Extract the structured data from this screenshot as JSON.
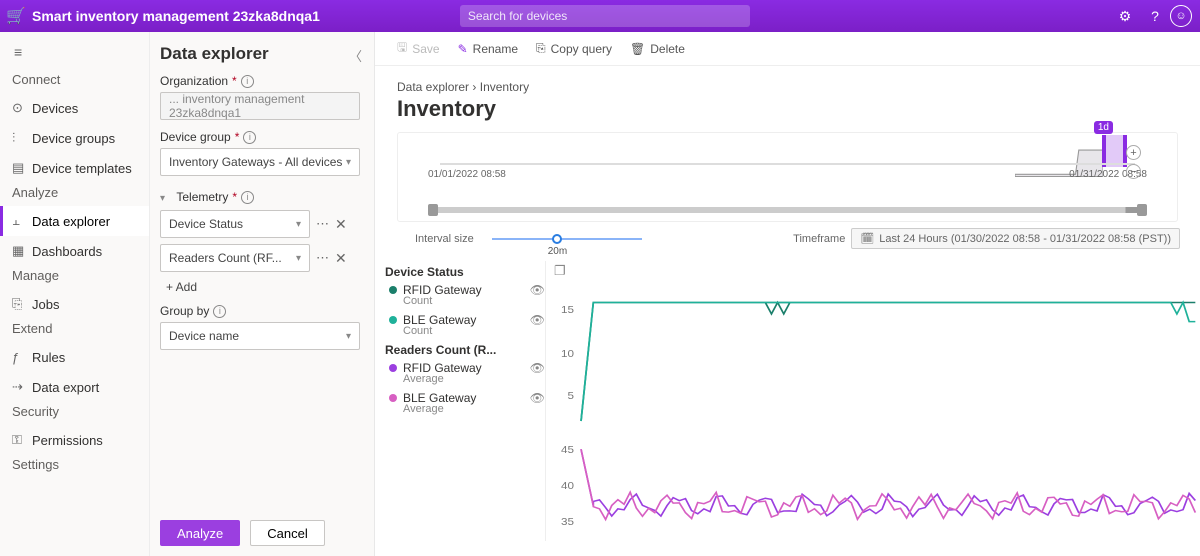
{
  "topbar": {
    "title": "Smart inventory management 23zka8dnqa1",
    "search_placeholder": "Search for devices",
    "avatar_initial": "☺"
  },
  "nav": {
    "groups": [
      {
        "label": "Connect",
        "items": [
          {
            "icon": "⊙",
            "label": "Devices"
          },
          {
            "icon": "⫶",
            "label": "Device groups"
          },
          {
            "icon": "▤",
            "label": "Device templates"
          }
        ]
      },
      {
        "label": "Analyze",
        "items": [
          {
            "icon": "⫠",
            "label": "Data explorer",
            "active": true
          },
          {
            "icon": "▦",
            "label": "Dashboards"
          }
        ]
      },
      {
        "label": "Manage",
        "items": [
          {
            "icon": "⎘",
            "label": "Jobs"
          }
        ]
      },
      {
        "label": "Extend",
        "items": [
          {
            "icon": "ƒ",
            "label": "Rules"
          },
          {
            "icon": "⇢",
            "label": "Data export"
          }
        ]
      },
      {
        "label": "Security",
        "items": [
          {
            "icon": "⚿",
            "label": "Permissions"
          }
        ]
      },
      {
        "label": "Settings",
        "items": []
      }
    ]
  },
  "panel": {
    "title": "Data explorer",
    "org_label": "Organization",
    "org_value": "... inventory management 23zka8dnqa1",
    "dg_label": "Device group",
    "dg_value": "Inventory Gateways - All devices",
    "tel_label": "Telemetry",
    "tel": [
      "Device Status",
      "Readers Count (RF..."
    ],
    "add": "+ Add",
    "groupby_label": "Group by",
    "groupby_value": "Device name",
    "analyze": "Analyze",
    "cancel": "Cancel"
  },
  "toolbar": {
    "save": "Save",
    "rename": "Rename",
    "copy": "Copy query",
    "delete": "Delete"
  },
  "crumb": {
    "root": "Data explorer",
    "leaf": "Inventory"
  },
  "page_title": "Inventory",
  "timeline": {
    "start": "01/01/2022 08:58",
    "end": "01/31/2022 08:58",
    "pill": "1d"
  },
  "controls": {
    "interval_label": "Interval size",
    "interval_value": "20m",
    "timeframe_label": "Timeframe",
    "timeframe_value": "Last 24 Hours (01/30/2022 08:58 - 01/31/2022 08:58 (PST))"
  },
  "legend": {
    "group1": "Device Status",
    "group2": "Readers Count (R...",
    "items1": [
      {
        "color": "#1b7f6b",
        "name": "RFID Gateway",
        "sub": "Count"
      },
      {
        "color": "#1fb19a",
        "name": "BLE Gateway",
        "sub": "Count"
      }
    ],
    "items2": [
      {
        "color": "#9b3fe0",
        "name": "RFID Gateway",
        "sub": "Average"
      },
      {
        "color": "#d75fc2",
        "name": "BLE Gateway",
        "sub": "Average"
      }
    ]
  },
  "chart_data": {
    "type": "line",
    "top": {
      "ylabel": "",
      "yticks": [
        5,
        10,
        15
      ],
      "ylim": [
        0,
        17
      ],
      "x_range": [
        "2022-01-30T08:58",
        "2022-01-31T08:58"
      ],
      "series": [
        {
          "name": "RFID Gateway Count",
          "color": "#1b7f6b",
          "points": [
            [
              0,
              0
            ],
            [
              2,
              15.5
            ],
            [
              100,
              15.5
            ]
          ],
          "dips": [
            [
              31,
              14
            ],
            [
              33,
              14
            ]
          ]
        },
        {
          "name": "BLE Gateway Count",
          "color": "#1fb19a",
          "points": [
            [
              0,
              0
            ],
            [
              2,
              15.5
            ],
            [
              96,
              15.5
            ],
            [
              97,
              14
            ],
            [
              98,
              15.5
            ],
            [
              99,
              13
            ],
            [
              100,
              13
            ]
          ]
        }
      ]
    },
    "bottom": {
      "ylabel": "",
      "yticks": [
        35,
        40,
        45
      ],
      "ylim": [
        32,
        47
      ],
      "x_range": [
        "2022-01-30T08:58",
        "2022-01-31T08:58"
      ],
      "series": [
        {
          "name": "RFID Gateway Average",
          "color": "#9b3fe0",
          "baseline": 37,
          "amplitude": 2
        },
        {
          "name": "BLE Gateway Average",
          "color": "#d75fc2",
          "baseline": 37,
          "amplitude": 3
        }
      ]
    }
  }
}
